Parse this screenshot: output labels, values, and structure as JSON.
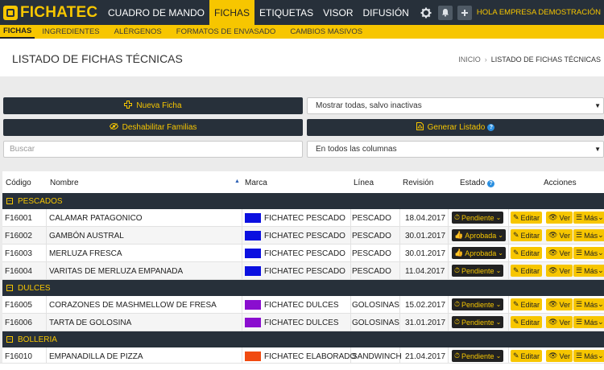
{
  "app": {
    "logo_text": "FICHATEC"
  },
  "top_nav": {
    "items": [
      "CUADRO DE MANDO",
      "FICHAS",
      "ETIQUETAS",
      "VISOR",
      "DIFUSIÓN"
    ],
    "active": "FICHAS",
    "user_link": "HOLA EMPRESA DEMOSTRACIÓN"
  },
  "sub_nav": {
    "items": [
      "FICHAS",
      "INGREDIENTES",
      "ALÉRGENOS",
      "FORMATOS DE ENVASADO",
      "CAMBIOS MASIVOS"
    ],
    "active": "FICHAS"
  },
  "page": {
    "title": "LISTADO DE FICHAS TÉCNICAS",
    "breadcrumb_home": "INICIO",
    "breadcrumb_current": "LISTADO DE FICHAS TÉCNICAS"
  },
  "controls": {
    "new_button": "Nueva Ficha",
    "families_button": "Deshabilitar Familias",
    "listing_button": "Generar Listado",
    "filter_select": "Mostrar todas, salvo inactivas",
    "search_placeholder": "Buscar",
    "columns_select": "En todos las columnas"
  },
  "table": {
    "headers": {
      "code": "Código",
      "name": "Nombre",
      "brand": "Marca",
      "line": "Línea",
      "revision": "Revisión",
      "status": "Estado",
      "actions": "Acciones"
    },
    "action_labels": {
      "edit": "Editar",
      "view": "Ver",
      "more": "Más"
    },
    "groups": [
      {
        "name": "PESCADOS",
        "rows": [
          {
            "code": "F16001",
            "name": "CALAMAR PATAGONICO",
            "brand": "FICHATEC PESCADO",
            "brand_color": "#0b10e0",
            "line": "PESCADO",
            "revision": "18.04.2017",
            "status": "Pendiente"
          },
          {
            "code": "F16002",
            "name": "GAMBÓN AUSTRAL",
            "brand": "FICHATEC PESCADO",
            "brand_color": "#0b10e0",
            "line": "PESCADO",
            "revision": "30.01.2017",
            "status": "Aprobada"
          },
          {
            "code": "F16003",
            "name": "MERLUZA FRESCA",
            "brand": "FICHATEC PESCADO",
            "brand_color": "#0b10e0",
            "line": "PESCADO",
            "revision": "30.01.2017",
            "status": "Aprobada"
          },
          {
            "code": "F16004",
            "name": "VARITAS DE MERLUZA EMPANADA",
            "brand": "FICHATEC PESCADO",
            "brand_color": "#0b10e0",
            "line": "PESCADO",
            "revision": "11.04.2017",
            "status": "Pendiente"
          }
        ]
      },
      {
        "name": "DULCES",
        "rows": [
          {
            "code": "F16005",
            "name": "CORAZONES DE MASHMELLOW DE FRESA",
            "brand": "FICHATEC DULCES",
            "brand_color": "#8a0ecf",
            "line": "GOLOSINAS",
            "revision": "15.02.2017",
            "status": "Pendiente"
          },
          {
            "code": "F16006",
            "name": "TARTA DE GOLOSINA",
            "brand": "FICHATEC DULCES",
            "brand_color": "#8a0ecf",
            "line": "GOLOSINAS",
            "revision": "31.01.2017",
            "status": "Pendiente"
          }
        ]
      },
      {
        "name": "BOLLERIA",
        "rows": [
          {
            "code": "F16010",
            "name": "EMPANADILLA DE PIZZA",
            "brand": "FICHATEC ELABORADO",
            "brand_color": "#f04a10",
            "line": "SANDWINCH",
            "revision": "21.04.2017",
            "status": "Pendiente"
          }
        ]
      }
    ]
  },
  "colors": {
    "accent": "#f7c600",
    "dark": "#27303a",
    "info": "#2b8fe0"
  }
}
